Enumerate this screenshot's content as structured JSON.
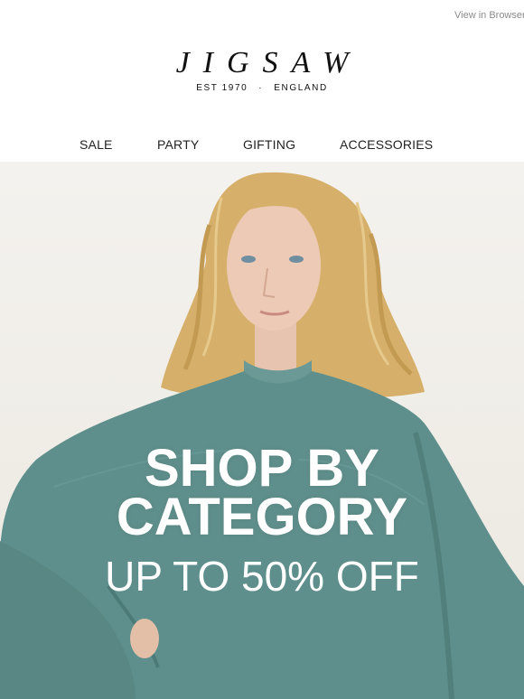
{
  "header": {
    "view_in_browser": "View in Browser"
  },
  "brand": {
    "name": "JIGSAW",
    "est": "EST 1970",
    "separator": "·",
    "country": "ENGLAND"
  },
  "nav": {
    "items": [
      "SALE",
      "PARTY",
      "GIFTING",
      "ACCESSORIES"
    ]
  },
  "hero": {
    "headline_line1": "SHOP BY",
    "headline_line2": "CATEGORY",
    "subheadline": "UP TO 50% OFF",
    "sweater_color": "#5f8f8c",
    "hair_color": "#d9b36a"
  }
}
